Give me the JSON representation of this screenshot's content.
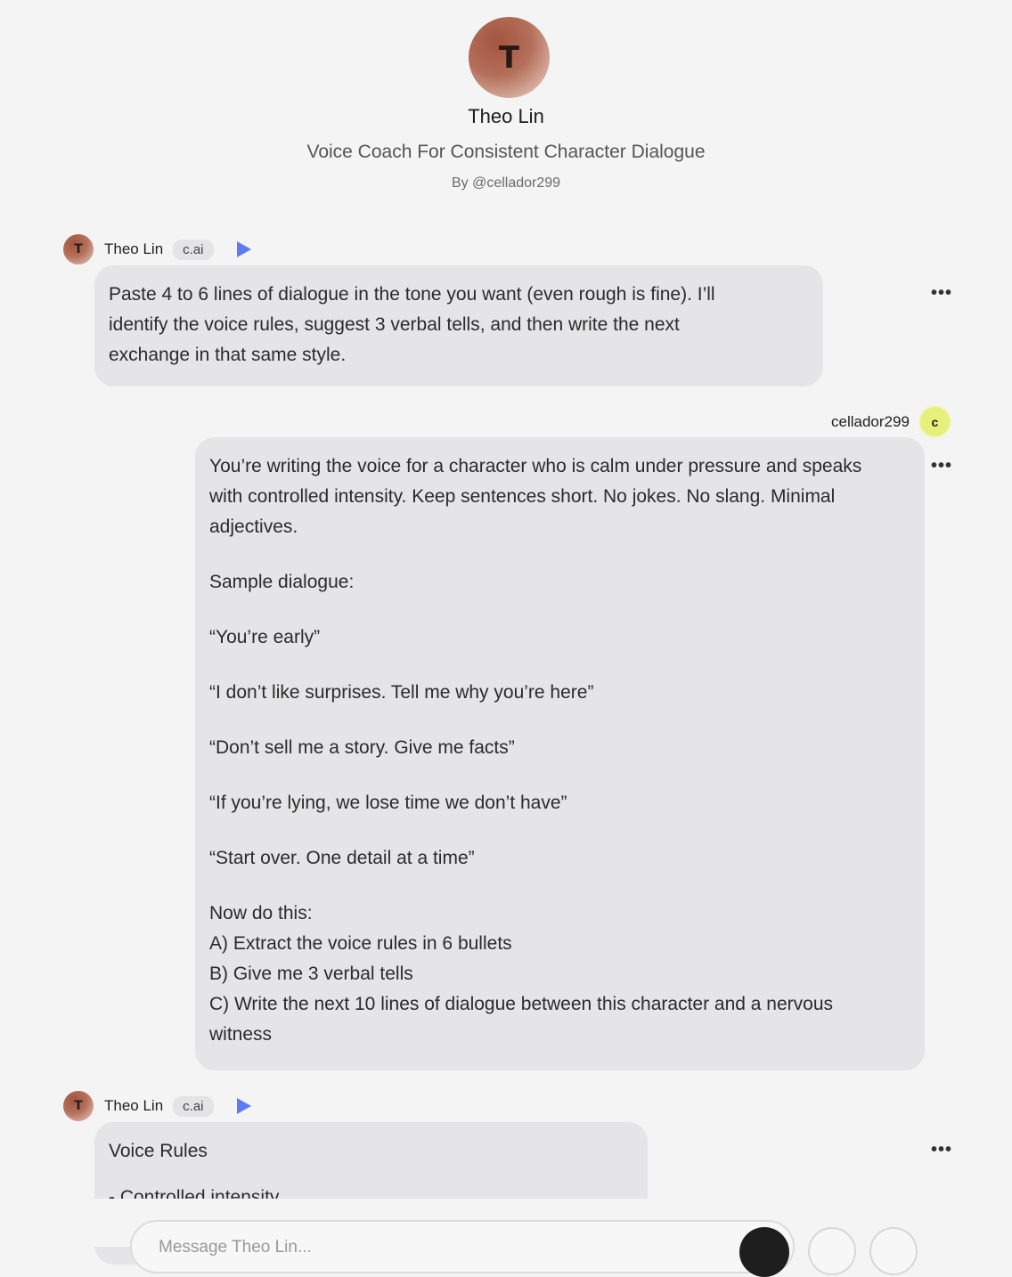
{
  "character": {
    "initial": "T",
    "name": "Theo Lin",
    "tagline": "Voice Coach For Consistent Character Dialogue",
    "by": "By @cellador299"
  },
  "messages": [
    {
      "author": "Theo Lin",
      "badge": "c.ai",
      "avatar_initial": "T",
      "lines": [
        "Paste 4 to 6 lines of dialogue in the tone you want (even rough is fine). I’ll",
        "identify the voice rules, suggest 3 verbal tells, and then write the next",
        "exchange in that same style."
      ],
      "menu": "•••"
    },
    {
      "author": "cellador299",
      "avatar_initial": "c",
      "paragraphs": [
        [
          "You’re writing the voice for a character who is calm under pressure and speaks",
          "with controlled intensity. Keep sentences short. No jokes. No slang. Minimal",
          "adjectives."
        ],
        [
          "Sample dialogue:"
        ],
        [
          "“You’re early”"
        ],
        [
          "“I don’t like surprises. Tell me why you’re here”"
        ],
        [
          "“Don’t sell me a story. Give me facts”"
        ],
        [
          "“If you’re lying, we lose time we don’t have”"
        ],
        [
          "“Start over. One detail at a time”"
        ],
        [
          "Now do this:",
          "A) Extract the voice rules in 6 bullets",
          "B) Give me 3 verbal tells",
          "C) Write the next 10 lines of dialogue between this character and a nervous",
          "witness"
        ]
      ],
      "menu": "•••"
    },
    {
      "author": "Theo Lin",
      "badge": "c.ai",
      "avatar_initial": "T",
      "lines": [
        "Voice Rules",
        "- Controlled intensity"
      ],
      "menu": "•••"
    }
  ],
  "composer": {
    "placeholder": "Message Theo Lin..."
  }
}
